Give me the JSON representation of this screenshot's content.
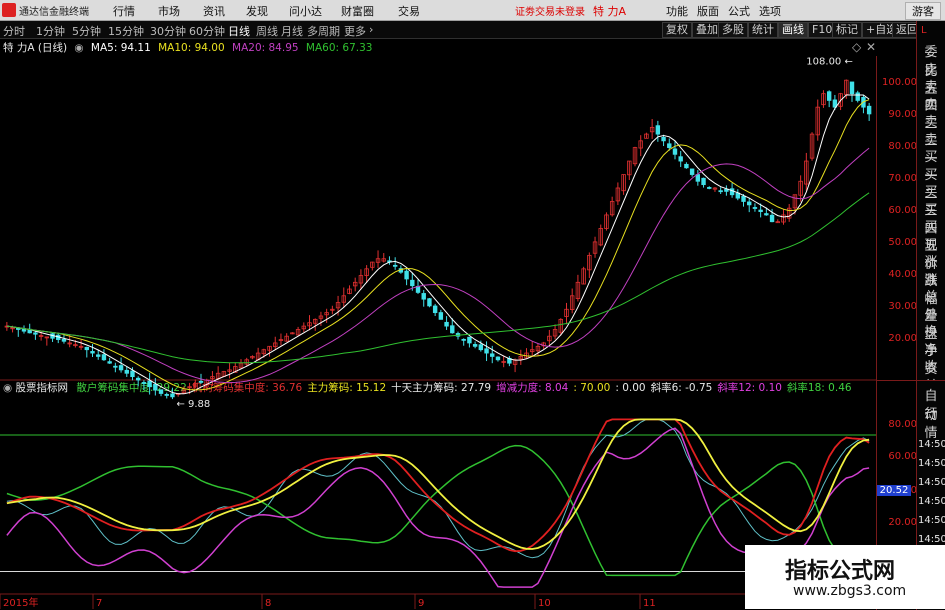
{
  "menubar": {
    "app_title": "通达信金融终端",
    "items": [
      "行情",
      "市场",
      "资讯",
      "发现",
      "问小达",
      "财富圈",
      "交易"
    ],
    "alert": "证劵交易未登录",
    "stock": "特 力A",
    "right_items": [
      "功能",
      "版面",
      "公式",
      "选项"
    ],
    "guest": "游客"
  },
  "periodbar": {
    "periods": [
      "分时",
      "1分钟",
      "5分钟",
      "15分钟",
      "30分钟",
      "60分钟",
      "日线",
      "周线",
      "月线",
      "多周期",
      "更多"
    ],
    "active": "日线",
    "buttons": [
      "复权",
      "叠加",
      "多股",
      "统计",
      "画线",
      "F10",
      "标记",
      "+自选",
      "返回"
    ]
  },
  "kline_info": {
    "name": "特 力A (日线)",
    "ma5": "MA5: 94.11",
    "ma10": "MA10: 94.00",
    "ma20": "MA20: 84.95",
    "ma60": "MA60: 67.33"
  },
  "indicator_info": {
    "name": "股票指标网",
    "items": [
      {
        "text": "散户筹码集中度: 29.22",
        "color": "#40d040"
      },
      {
        "text": "机构筹码集中度: 36.76",
        "color": "#e03030"
      },
      {
        "text": "主力筹码: 15.12",
        "color": "#e8e020"
      },
      {
        "text": "十天主力筹码: 27.79",
        "color": "#e8e8e8"
      },
      {
        "text": "增减力度: 8.04",
        "color": "#e040e0"
      },
      {
        "text": ": 70.00",
        "color": "#e8e020"
      },
      {
        "text": ": 0.00",
        "color": "#e8e8e8"
      },
      {
        "text": "斜率6: -0.75",
        "color": "#e8e8e8"
      },
      {
        "text": "斜率12: 0.10",
        "color": "#e040e0"
      },
      {
        "text": "斜率18: 0.46",
        "color": "#40d040"
      }
    ]
  },
  "price_axis": [
    "100.00",
    "90.00",
    "80.00",
    "70.00",
    "60.00",
    "50.00",
    "40.00",
    "30.00",
    "20.00"
  ],
  "indicator_axis": [
    "80.00",
    "60.00",
    "40.00",
    "20.00"
  ],
  "annotations": {
    "high": "108.00",
    "low": "9.88",
    "current": "20.52"
  },
  "x_axis": [
    "2015年",
    "7",
    "8",
    "9",
    "10",
    "11"
  ],
  "right_panel": {
    "header": "L",
    "items": [
      "委比",
      "卖五",
      "卖四",
      "卖三",
      "卖二",
      "卖一",
      "买一",
      "买二",
      "买三",
      "买四",
      "买五",
      "现价",
      "涨跌",
      "涨幅",
      "总量",
      "外盘",
      "换手",
      "净资",
      "收益"
    ]
  },
  "right_panel2": {
    "items": [
      "自动",
      "行情"
    ],
    "times": [
      "14:50",
      "14:50",
      "14:50",
      "14:50",
      "14:50",
      "14:50",
      "14:50",
      "14:50"
    ]
  },
  "watermark": {
    "title": "指标公式网",
    "url": "www.zbgs3.com"
  },
  "colors": {
    "up": "#e03030",
    "down": "#40e0e8",
    "ma5": "#ffffff",
    "ma10": "#e8e020",
    "ma20": "#c040c0",
    "ma60": "#30c030"
  },
  "chart_data": {
    "type": "candlestick",
    "price_range": [
      15,
      110
    ],
    "indicator_range": [
      -10,
      90
    ],
    "closes": [
      31,
      30.5,
      30,
      29.5,
      29,
      28.6,
      28.2,
      27.8,
      27.4,
      27,
      26.5,
      26,
      25.5,
      25,
      24,
      23,
      22,
      21,
      20,
      19,
      18,
      17,
      16,
      15,
      14,
      13,
      12,
      11,
      10.5,
      10,
      11,
      12,
      13,
      14,
      14.5,
      15,
      16,
      17,
      17.5,
      18,
      19,
      20,
      21,
      22,
      23,
      24,
      25,
      26,
      27,
      28,
      29,
      30,
      31,
      32,
      33,
      34,
      35,
      36,
      38,
      40,
      42,
      44,
      46,
      48,
      50,
      51,
      51,
      50,
      49,
      47,
      45,
      43,
      41,
      39,
      37,
      35,
      33,
      31,
      29,
      28,
      27,
      26,
      25,
      24,
      23,
      22,
      21,
      20.5,
      20,
      21,
      22,
      23,
      24,
      25,
      26,
      28,
      30,
      33,
      36,
      40,
      44,
      48,
      52,
      56,
      60,
      64,
      68,
      72,
      76,
      80,
      84,
      86,
      88,
      90,
      88,
      86,
      84,
      82,
      80,
      78,
      76,
      74,
      73,
      72,
      72,
      71,
      71,
      70,
      69,
      68,
      67,
      66,
      65,
      64,
      62,
      62,
      64,
      66,
      70,
      74,
      80,
      88,
      96,
      100,
      98,
      96,
      100,
      104,
      100,
      98,
      96,
      94
    ]
  }
}
